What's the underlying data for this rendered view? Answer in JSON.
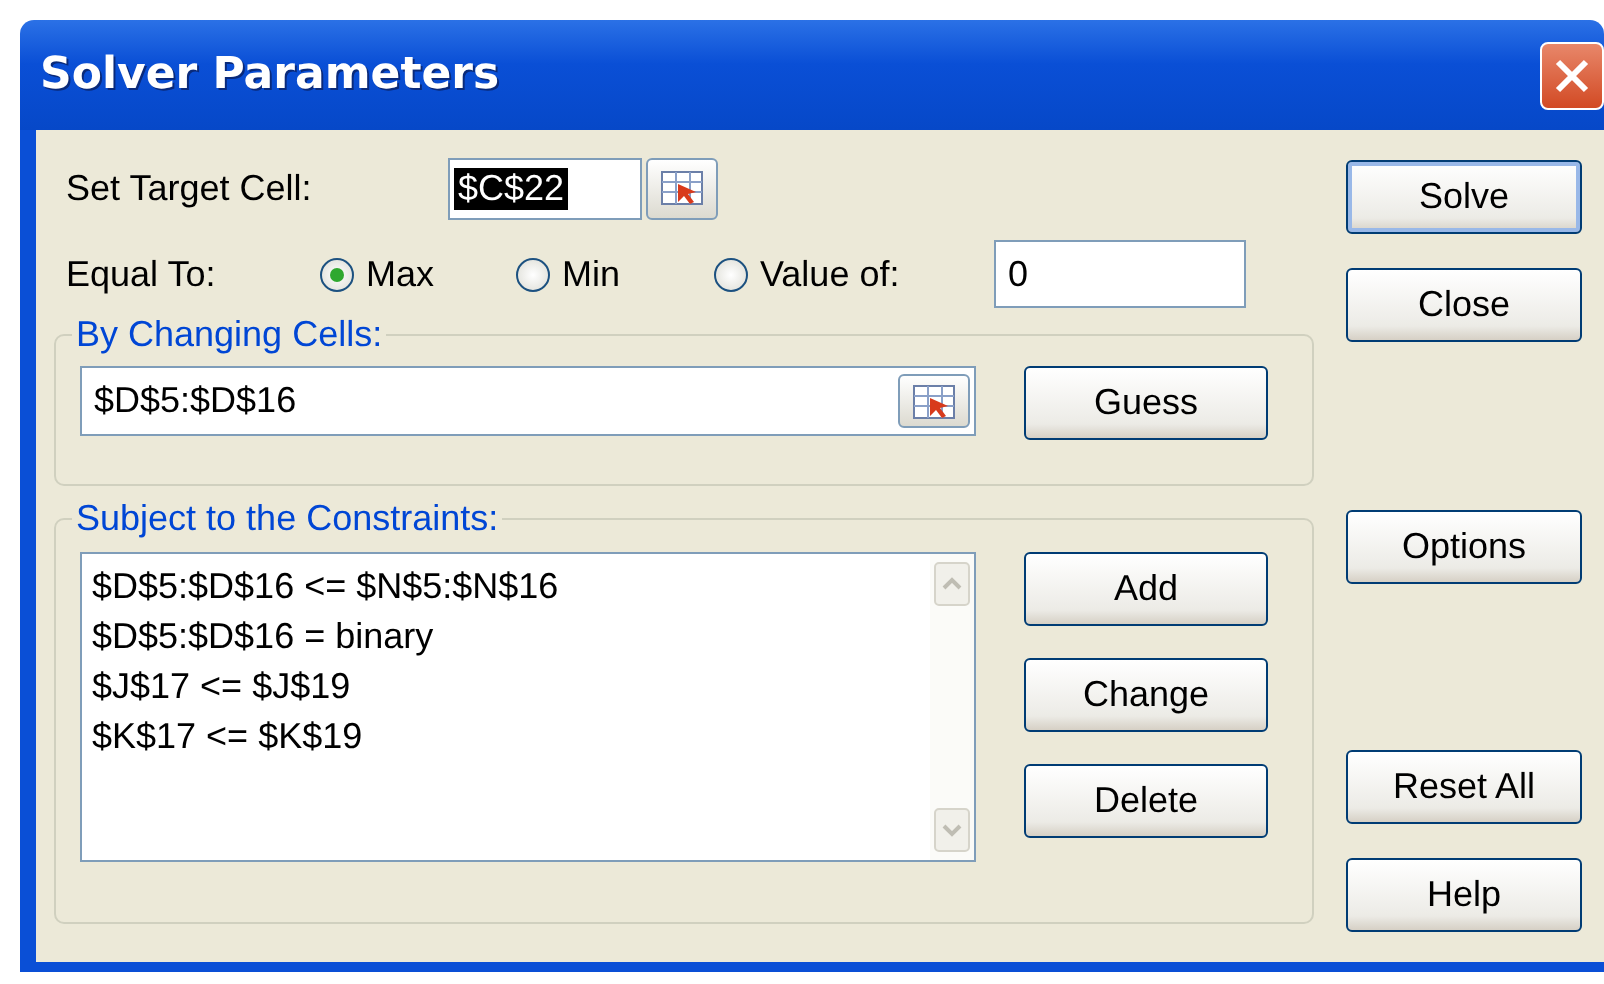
{
  "window": {
    "title": "Solver Parameters"
  },
  "target": {
    "label": "Set Target Cell:",
    "value": "$C$22",
    "text_selected": true
  },
  "equal_to": {
    "label": "Equal To:",
    "options": [
      {
        "label": "Max",
        "selected": true
      },
      {
        "label": "Min",
        "selected": false
      },
      {
        "label": "Value of:",
        "selected": false
      }
    ],
    "value": "0"
  },
  "changing_cells": {
    "legend": "By Changing Cells:",
    "value": "$D$5:$D$16",
    "button": "Guess"
  },
  "constraints": {
    "legend": "Subject to the Constraints:",
    "items": [
      "$D$5:$D$16 <= $N$5:$N$16",
      "$D$5:$D$16 = binary",
      "$J$17 <= $J$19",
      "$K$17 <= $K$19"
    ],
    "buttons": [
      "Add",
      "Change",
      "Delete"
    ]
  },
  "side_buttons": [
    {
      "label": "Solve",
      "kind": "default"
    },
    {
      "label": "Close",
      "kind": "plain"
    },
    {
      "label": "Options",
      "kind": "plain"
    },
    {
      "label": "Reset All",
      "kind": "plain"
    },
    {
      "label": "Help",
      "kind": "plain"
    }
  ]
}
